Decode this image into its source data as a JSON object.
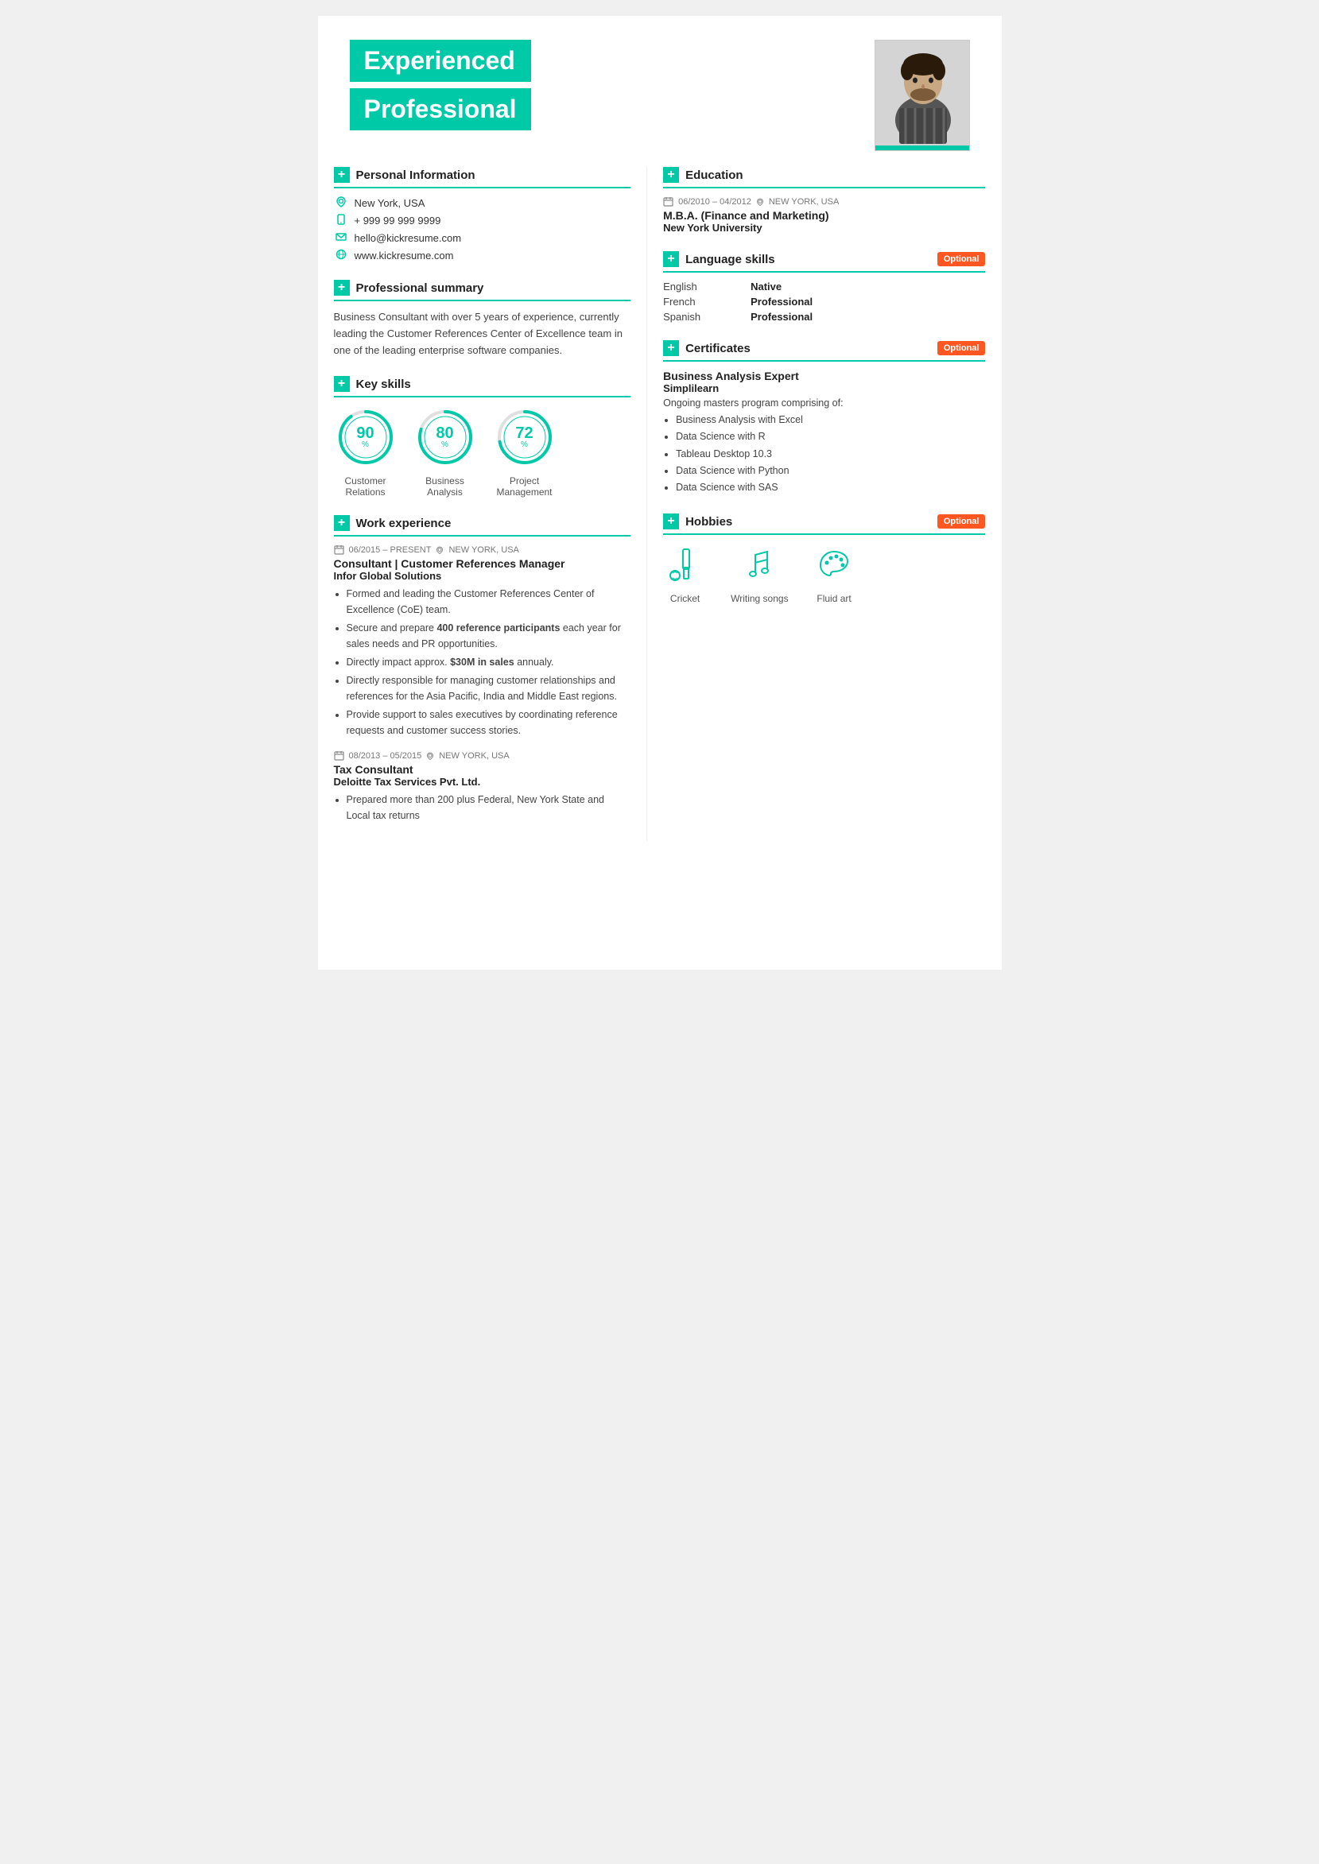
{
  "header": {
    "line1": "Experienced",
    "line2": "Professional"
  },
  "personal": {
    "section_title": "Personal Information",
    "location": "New York, USA",
    "phone": "+ 999 99 999 9999",
    "email": "hello@kickresume.com",
    "website": "www.kickresume.com"
  },
  "summary": {
    "section_title": "Professional summary",
    "text": "Business Consultant with over 5 years of experience, currently leading the Customer References Center of Excellence team in one of the leading enterprise software companies."
  },
  "skills": {
    "section_title": "Key skills",
    "items": [
      {
        "value": 90,
        "label": "Customer\nRelations"
      },
      {
        "value": 80,
        "label": "Business\nAnalysis"
      },
      {
        "value": 72,
        "label": "Project\nManagement"
      }
    ]
  },
  "work": {
    "section_title": "Work experience",
    "items": [
      {
        "date": "06/2015 – PRESENT",
        "location": "NEW YORK, USA",
        "title": "Consultant | Customer References Manager",
        "company": "Infor Global Solutions",
        "bullets": [
          "Formed and leading the Customer References Center of Excellence (CoE) team.",
          "Secure and prepare 400 reference participants each year for sales needs and PR opportunities.",
          "Directly impact approx. $30M in sales annualy.",
          "Directly responsible for managing customer relationships and references for the Asia Pacific, India and Middle East regions.",
          "Provide support to sales executives by coordinating reference requests and customer success stories."
        ],
        "bold_parts": [
          "400 reference participants",
          "$30M in sales"
        ]
      },
      {
        "date": "08/2013 – 05/2015",
        "location": "NEW YORK, USA",
        "title": "Tax Consultant",
        "company": "Deloitte Tax Services Pvt. Ltd.",
        "bullets": [
          "Prepared more than 200 plus Federal, New York State and Local tax returns"
        ]
      }
    ]
  },
  "education": {
    "section_title": "Education",
    "items": [
      {
        "date": "06/2010 – 04/2012",
        "location": "NEW YORK, USA",
        "degree": "M.B.A. (Finance and Marketing)",
        "school": "New York University"
      }
    ]
  },
  "languages": {
    "section_title": "Language skills",
    "optional": "Optional",
    "items": [
      {
        "name": "English",
        "level": "Native"
      },
      {
        "name": "French",
        "level": "Professional"
      },
      {
        "name": "Spanish",
        "level": "Professional"
      }
    ]
  },
  "certificates": {
    "section_title": "Certificates",
    "optional": "Optional",
    "title": "Business Analysis Expert",
    "issuer": "Simplilearn",
    "description": "Ongoing masters program comprising of:",
    "bullets": [
      "Business Analysis with Excel",
      "Data Science with R",
      "Tableau Desktop 10.3",
      "Data Science with Python",
      "Data Science with SAS"
    ]
  },
  "hobbies": {
    "section_title": "Hobbies",
    "optional": "Optional",
    "items": [
      {
        "label": "Cricket",
        "icon": "cricket"
      },
      {
        "label": "Writing songs",
        "icon": "music"
      },
      {
        "label": "Fluid art",
        "icon": "art"
      }
    ]
  },
  "accent_color": "#00c9a7",
  "optional_color": "#ff5722"
}
